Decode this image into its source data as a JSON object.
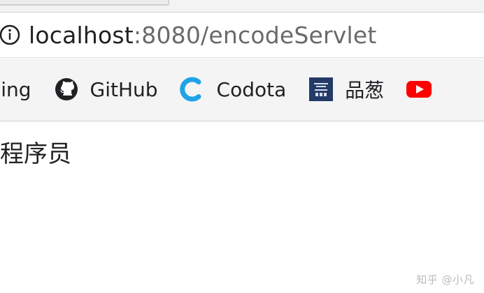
{
  "address_bar": {
    "url_host": "localhost",
    "url_rest": ":8080/encodeServlet",
    "icon": "info-icon"
  },
  "bookmarks": [
    {
      "label": "Bing",
      "icon": "bing-icon"
    },
    {
      "label": "GitHub",
      "icon": "github-icon"
    },
    {
      "label": "Codota",
      "icon": "codota-icon"
    },
    {
      "label": "品葱",
      "icon": "pincong-icon"
    },
    {
      "label": "",
      "icon": "youtube-icon"
    }
  ],
  "page": {
    "text": "程序员"
  },
  "watermark": {
    "text": "知乎 @小凡"
  },
  "colors": {
    "github": "#202124",
    "codota": "#1ea4e6",
    "pincong": "#233a67",
    "youtube": "#ff0000",
    "address_gray": "#6a6a6a"
  }
}
